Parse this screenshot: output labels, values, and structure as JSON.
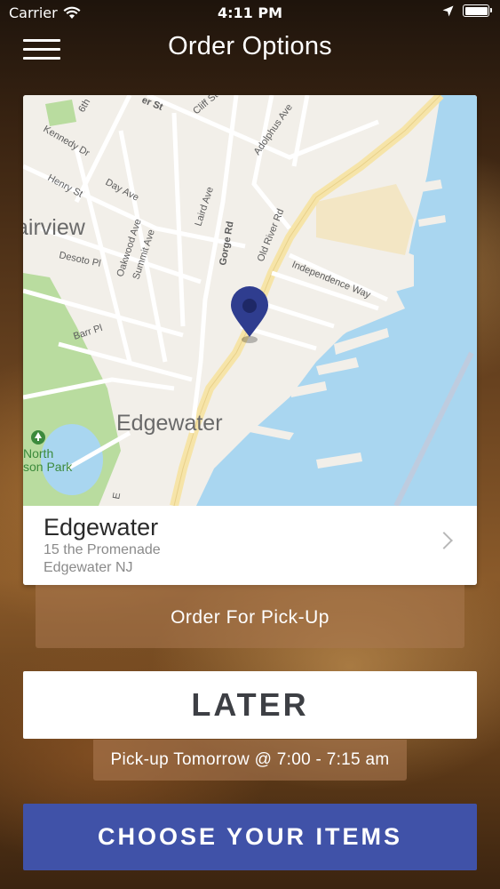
{
  "status_bar": {
    "carrier": "Carrier",
    "time": "4:11 PM"
  },
  "nav": {
    "title": "Order Options"
  },
  "map": {
    "labels": {
      "fairview": "airview",
      "edgewater": "Edgewater",
      "park": "North\nson Park",
      "park_line1": "North",
      "park_line2": "son Park",
      "gorge_rd": "Gorge Rd",
      "old_river_rd": "Old River Rd",
      "laird_ave": "Laird Ave",
      "oakwood_ave": "Oakwood Ave",
      "summit_ave": "Summit Ave",
      "day_ave": "Day Ave",
      "henry_st": "Henry St",
      "kennedy_dr": "Kennedy Dr",
      "desoto_pl": "Desoto Pl",
      "barr_pl": "Barr Pl",
      "cliff_st": "Cliff St",
      "adolphus_ave": "Adolphus Ave",
      "independence_way": "Independence Way",
      "er_st": "er St",
      "sixth": "6th",
      "e_label": "E"
    },
    "colors": {
      "land": "#f2efe9",
      "water": "#a9d6f0",
      "park": "#b9dc9f",
      "road": "#ffffff",
      "highway": "#f6e4a8",
      "pin": "#2f3d8f"
    }
  },
  "location": {
    "name": "Edgewater",
    "address_line1": "15 the Promenade",
    "address_line2": "Edgewater NJ"
  },
  "order_type": {
    "label": "Order For Pick-Up"
  },
  "timing": {
    "label": "LATER",
    "pickup_time": "Pick-up Tomorrow @ 7:00 - 7:15 am"
  },
  "cta": {
    "label": "CHOOSE YOUR ITEMS",
    "color": "#4052a8"
  }
}
